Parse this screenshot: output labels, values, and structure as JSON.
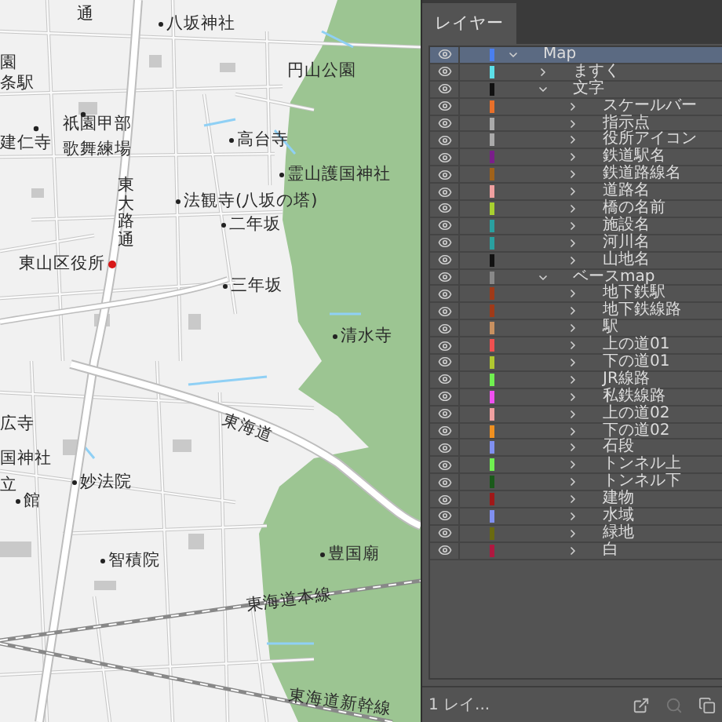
{
  "map": {
    "labels": [
      {
        "text": "通",
        "kind": "vertical"
      },
      {
        "text": "八坂神社",
        "kind": "place"
      },
      {
        "text": "円山公園",
        "kind": "plain"
      },
      {
        "text": "園",
        "kind": "plain"
      },
      {
        "text": "条駅",
        "kind": "plain"
      },
      {
        "text": "祇園甲部",
        "kind": "plain"
      },
      {
        "text": "建仁寺",
        "kind": "plain"
      },
      {
        "text": "歌舞練場",
        "kind": "plain"
      },
      {
        "text": "高台寺",
        "kind": "place"
      },
      {
        "text": "霊山護国神社",
        "kind": "place"
      },
      {
        "text": "東大路通",
        "kind": "vertical"
      },
      {
        "text": "法観寺(八坂の塔)",
        "kind": "place"
      },
      {
        "text": "二年坂",
        "kind": "place"
      },
      {
        "text": "東山区役所",
        "kind": "office"
      },
      {
        "text": "三年坂",
        "kind": "place"
      },
      {
        "text": "清水寺",
        "kind": "place"
      },
      {
        "text": "東海道",
        "kind": "road"
      },
      {
        "text": "広寺",
        "kind": "plain"
      },
      {
        "text": "国神社",
        "kind": "plain"
      },
      {
        "text": "立",
        "kind": "plain"
      },
      {
        "text": "館",
        "kind": "place"
      },
      {
        "text": "妙法院",
        "kind": "place"
      },
      {
        "text": "智積院",
        "kind": "place"
      },
      {
        "text": "豊国廟",
        "kind": "place"
      },
      {
        "text": "東海道本線",
        "kind": "road"
      },
      {
        "text": "東海道新幹線",
        "kind": "road"
      }
    ]
  },
  "layers_panel": {
    "tab": {
      "label": "レイヤー",
      "selected": true
    },
    "layers": [
      {
        "name": "Map",
        "color": "#4a7ff0",
        "expanded": true,
        "selected": true,
        "children": [
          {
            "name": "ますく",
            "color": "#5ce0e8",
            "expanded": false,
            "selected": false
          },
          {
            "name": "文字",
            "color": "#111111",
            "expanded": true,
            "selected": false,
            "children": [
              {
                "name": "スケールバー",
                "color": "#e8702a",
                "expanded": false,
                "selected": false
              },
              {
                "name": "指示点",
                "color": "#aaaaaa",
                "expanded": false,
                "selected": false
              },
              {
                "name": "役所アイコン",
                "color": "#aaaaaa",
                "expanded": false,
                "selected": false
              },
              {
                "name": "鉄道駅名",
                "color": "#7a1f8a",
                "expanded": false,
                "selected": false
              },
              {
                "name": "鉄道路線名",
                "color": "#a0621a",
                "expanded": false,
                "selected": false
              },
              {
                "name": "道路名",
                "color": "#f0a0a0",
                "expanded": false,
                "selected": false
              },
              {
                "name": "橋の名前",
                "color": "#a8d030",
                "expanded": false,
                "selected": false
              },
              {
                "name": "施設名",
                "color": "#2aa0a0",
                "expanded": false,
                "selected": false
              },
              {
                "name": "河川名",
                "color": "#2aa0a0",
                "expanded": false,
                "selected": false
              },
              {
                "name": "山地名",
                "color": "#111111",
                "expanded": false,
                "selected": false
              }
            ]
          },
          {
            "name": "ベースmap",
            "color": "#888888",
            "expanded": true,
            "selected": false,
            "children": [
              {
                "name": "地下鉄駅",
                "color": "#a03a18",
                "expanded": false,
                "selected": false
              },
              {
                "name": "地下鉄線路",
                "color": "#a03a18",
                "expanded": false,
                "selected": false
              },
              {
                "name": "駅",
                "color": "#c89060",
                "expanded": false,
                "selected": false
              },
              {
                "name": "上の道01",
                "color": "#f05050",
                "expanded": false,
                "selected": false
              },
              {
                "name": "下の道01",
                "color": "#b0c830",
                "expanded": false,
                "selected": false
              },
              {
                "name": "JR線路",
                "color": "#70f050",
                "expanded": false,
                "selected": false
              },
              {
                "name": "私鉄線路",
                "color": "#f050f0",
                "expanded": false,
                "selected": false
              },
              {
                "name": "上の道02",
                "color": "#f0a0a0",
                "expanded": false,
                "selected": false
              },
              {
                "name": "下の道02",
                "color": "#f09020",
                "expanded": false,
                "selected": false
              },
              {
                "name": "石段",
                "color": "#8090f0",
                "expanded": false,
                "selected": false
              },
              {
                "name": "トンネル上",
                "color": "#70f050",
                "expanded": false,
                "selected": false
              },
              {
                "name": "トンネル下",
                "color": "#1a5a1a",
                "expanded": false,
                "selected": false
              },
              {
                "name": "建物",
                "color": "#a01818",
                "expanded": false,
                "selected": false
              },
              {
                "name": "水域",
                "color": "#8090f0",
                "expanded": false,
                "selected": false
              },
              {
                "name": "緑地",
                "color": "#6a6a10",
                "expanded": false,
                "selected": false
              },
              {
                "name": "白",
                "color": "#b01840",
                "expanded": false,
                "selected": false
              }
            ]
          }
        ]
      }
    ],
    "footer": {
      "count": "1 レイ..."
    }
  }
}
